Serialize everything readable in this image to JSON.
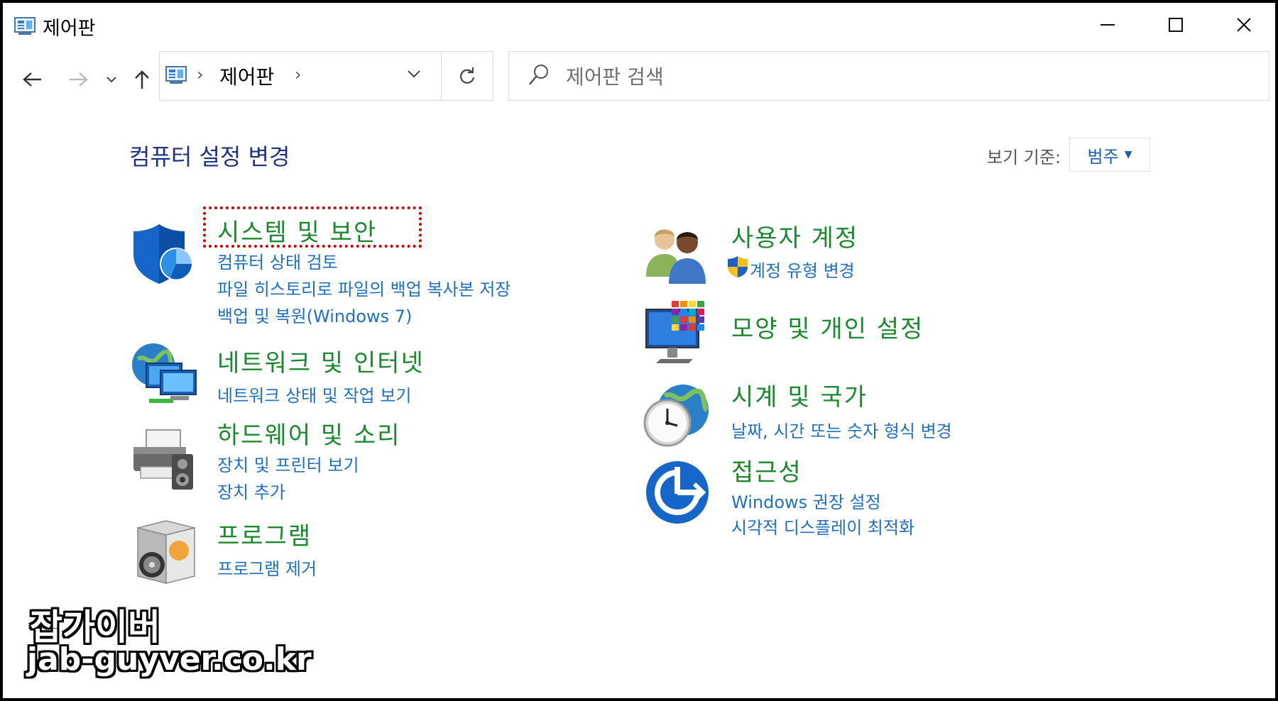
{
  "window": {
    "title": "제어판",
    "accent": "#1e3287"
  },
  "titlebar_icons": [
    "control-panel-icon",
    "minimize-icon",
    "maximize-icon",
    "close-icon"
  ],
  "address_bar": {
    "breadcrumb": "제어판",
    "separator": "›",
    "icons": [
      "back-arrow-icon",
      "forward-arrow-icon",
      "recent-chevron-icon",
      "up-arrow-icon",
      "dropdown-chevron-icon",
      "refresh-icon"
    ]
  },
  "search": {
    "placeholder": "제어판 검색",
    "value": "",
    "icon": "search-icon"
  },
  "main": {
    "heading": "컴퓨터 설정 변경",
    "view_by_label": "보기 기준:",
    "view_by_value": "범주",
    "title_color": "#1b8a2e",
    "link_color": "#1f6fc2",
    "categories": [
      {
        "title": "시스템 및 보안",
        "icon": "system-security-shield-icon",
        "links": [
          "컴퓨터 상태 검토",
          "파일 히스토리로 파일의 백업 복사본 저장",
          "백업 및 복원(Windows 7)"
        ],
        "highlighted": true
      },
      {
        "title": "네트워크 및 인터넷",
        "icon": "network-globe-icon",
        "links": [
          "네트워크 상태 및 작업 보기"
        ]
      },
      {
        "title": "하드웨어 및 소리",
        "icon": "hardware-printer-speaker-icon",
        "links": [
          "장치 및 프린터 보기",
          "장치 추가"
        ]
      },
      {
        "title": "프로그램",
        "icon": "programs-box-icon",
        "links": [
          "프로그램 제거"
        ]
      },
      {
        "title": "사용자 계정",
        "icon": "user-accounts-people-icon",
        "links": [
          "계정 유형 변경"
        ],
        "link_icon": "uac-shield-icon"
      },
      {
        "title": "모양 및 개인 설정",
        "icon": "appearance-monitor-icon",
        "links": []
      },
      {
        "title": "시계 및 국가",
        "icon": "clock-globe-icon",
        "links": [
          "날짜, 시간 또는 숫자 형식 변경"
        ]
      },
      {
        "title": "접근성",
        "icon": "ease-of-access-icon",
        "links": [
          "Windows 권장 설정",
          "시각적 디스플레이 최적화"
        ]
      }
    ]
  },
  "watermark": {
    "line1": "잡가이버",
    "line2": "jab-guyver.co.kr"
  }
}
